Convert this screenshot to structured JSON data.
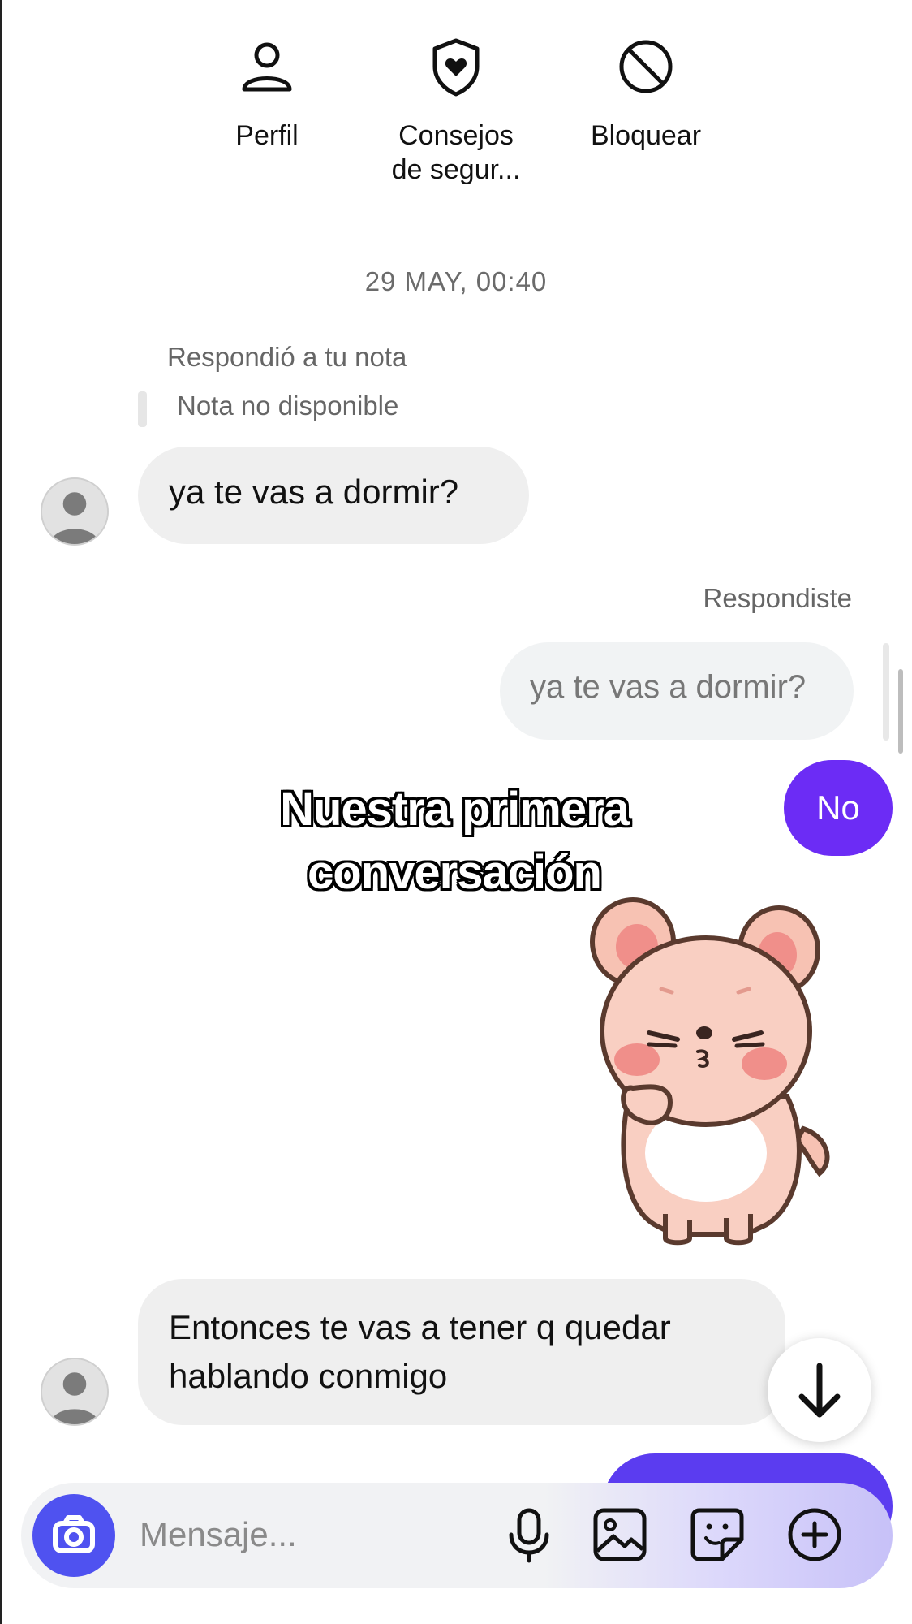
{
  "actions": {
    "perfil": {
      "label": "Perfil",
      "icon": "person-icon"
    },
    "consejos": {
      "label": "Consejos\nde segur...",
      "icon": "shield-heart-icon"
    },
    "bloquear": {
      "label": "Bloquear",
      "icon": "block-icon"
    }
  },
  "timestamp": "29 MAY, 00:40",
  "messages": {
    "reply_context": {
      "label": "Respondió a tu nota",
      "note": "Nota no disponible"
    },
    "incoming_1": "ya te vas a dormir?",
    "replied_label": "Respondiste",
    "quoted": "ya te vas a dormir?",
    "outgoing_1": "No",
    "incoming_2": "Entonces te vas a tener q quedar hablando conmigo"
  },
  "overlay": {
    "line1": "Nuestra primera",
    "line2": "conversación"
  },
  "composer": {
    "placeholder": "Mensaje..."
  },
  "colors": {
    "outgoing": "#6c2cf5",
    "camera": "#4f52f0"
  }
}
